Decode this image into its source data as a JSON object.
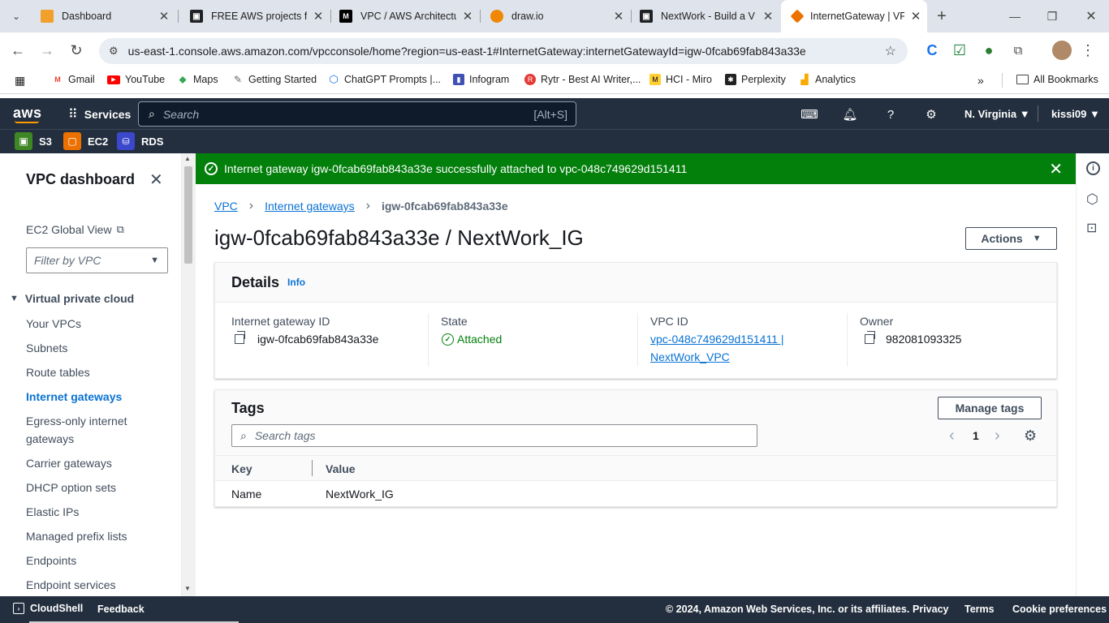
{
  "browser": {
    "tabs": [
      {
        "title": "Dashboard",
        "icon": "aws-cube-icon",
        "color": "#f0a02b"
      },
      {
        "title": "FREE AWS projects fo",
        "icon": "nextwork-icon",
        "color": "#202124"
      },
      {
        "title": "VPC / AWS Architectu",
        "icon": "medium-icon",
        "color": "#000000"
      },
      {
        "title": "draw.io",
        "icon": "drawio-icon",
        "color": "#f08705"
      },
      {
        "title": "NextWork - Build a V",
        "icon": "nextwork-icon",
        "color": "#202124"
      },
      {
        "title": "InternetGateway | VP",
        "icon": "aws-vpc-icon",
        "color": "#ed7100"
      }
    ],
    "url": "us-east-1.console.aws.amazon.com/vpcconsole/home?region=us-east-1#InternetGateway:internetGatewayId=igw-0fcab69fab843a33e",
    "bookmarks": [
      "Gmail",
      "YouTube",
      "Maps",
      "Getting Started",
      "ChatGPT Prompts |...",
      "Infogram",
      "Rytr - Best AI Writer,...",
      "HCI - Miro",
      "Perplexity",
      "Analytics"
    ],
    "all_bookmarks": "All Bookmarks"
  },
  "aws_nav": {
    "logo": "aws",
    "services": "Services",
    "search_placeholder": "Search",
    "search_shortcut": "[Alt+S]",
    "region": "N. Virginia",
    "user": "kissi09",
    "favorites": [
      "S3",
      "EC2",
      "RDS"
    ]
  },
  "sidebar": {
    "title": "VPC dashboard",
    "ec2_global_view": "EC2 Global View",
    "filter_placeholder": "Filter by VPC",
    "section": "Virtual private cloud",
    "items": [
      "Your VPCs",
      "Subnets",
      "Route tables",
      "Internet gateways",
      "Egress-only internet gateways",
      "Carrier gateways",
      "DHCP option sets",
      "Elastic IPs",
      "Managed prefix lists",
      "Endpoints",
      "Endpoint services"
    ],
    "active_item": "Internet gateways"
  },
  "flash": {
    "message": "Internet gateway igw-0fcab69fab843a33e successfully attached to vpc-048c749629d151411"
  },
  "breadcrumb": [
    "VPC",
    "Internet gateways",
    "igw-0fcab69fab843a33e"
  ],
  "page_title": "igw-0fcab69fab843a33e / NextWork_IG",
  "actions_label": "Actions",
  "details": {
    "title": "Details",
    "info": "Info",
    "igw_label": "Internet gateway ID",
    "igw_value": "igw-0fcab69fab843a33e",
    "state_label": "State",
    "state_value": "Attached",
    "vpc_label": "VPC ID",
    "vpc_value_line1": "vpc-048c749629d151411 |",
    "vpc_value_line2": "NextWork_VPC",
    "owner_label": "Owner",
    "owner_value": "982081093325"
  },
  "tags": {
    "title": "Tags",
    "manage_label": "Manage tags",
    "search_placeholder": "Search tags",
    "page": "1",
    "columns": [
      "Key",
      "Value"
    ],
    "rows": [
      {
        "key": "Name",
        "value": "NextWork_IG"
      }
    ]
  },
  "footer": {
    "cloudshell": "CloudShell",
    "feedback": "Feedback",
    "copyright": "© 2024, Amazon Web Services, Inc. or its affiliates.",
    "privacy": "Privacy",
    "terms": "Terms",
    "cookies": "Cookie preferences"
  },
  "colors": {
    "aws_nav": "#232f3e",
    "success": "#037f0c",
    "link": "#0972d3",
    "aws_orange": "#ff9900"
  }
}
